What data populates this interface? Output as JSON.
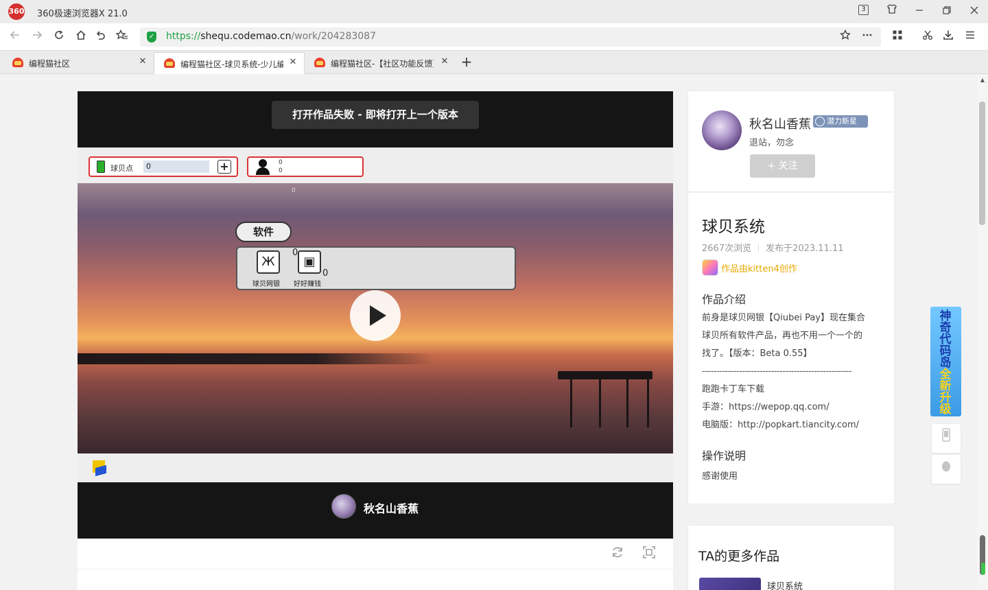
{
  "window": {
    "title": "360极速浏览器X 21.0",
    "tab_count": "3"
  },
  "toolbar": {
    "url_scheme": "https://",
    "url_host": "shequ.codemao.cn",
    "url_path": "/work/204283087"
  },
  "tabs": [
    {
      "label": "编程猫社区",
      "active": false
    },
    {
      "label": "编程猫社区-球贝系统-少儿编程",
      "active": true
    },
    {
      "label": "编程猫社区-【社区功能反馈】",
      "active": false
    }
  ],
  "player": {
    "toast": "打开作品失败 - 即将打开上一个版本",
    "hud_points_label": "球贝点",
    "hud_points_value": "0",
    "hud_plus": "+",
    "hud_user_value": "0",
    "hud_user_sub": "0",
    "hud_float_value": "0",
    "apps_label": "软件",
    "app1_name": "球贝网银",
    "app1_num": "0",
    "app2_name": "好好赚钱",
    "app2_num": "0",
    "author_name": "秋名山香蕉"
  },
  "author_card": {
    "name": "秋名山香蕉",
    "badge": "潜力新星",
    "bio": "退站，勿念",
    "follow_label": "+ 关注"
  },
  "work_info": {
    "title": "球贝系统",
    "views": "2667次浏览",
    "published": "发布于2023.11.11",
    "kitten_label": "作品由kitten4创作",
    "intro_heading": "作品介绍",
    "intro_lines": [
      "前身是球贝网银【Qiubei Pay】现在集合",
      "球贝所有软件产品，再也不用一个一个的",
      "找了。【版本：Beta 0.55】",
      "----------------------------------------------------",
      "跑跑卡丁车下载",
      "手游：https://wepop.qq.com/",
      "电脑版：http://popkart.tiancity.com/"
    ],
    "ops_heading": "操作说明",
    "ops_text": "感谢使用"
  },
  "more_works": {
    "title": "TA的更多作品",
    "first_item": "球贝系统"
  },
  "promo": {
    "text_a": "神奇代码岛",
    "text_b": "全新升级"
  }
}
